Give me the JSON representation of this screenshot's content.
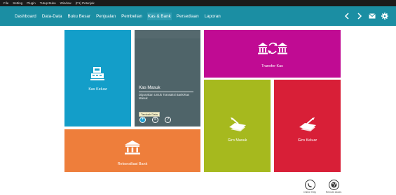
{
  "menubar": {
    "items": [
      "File",
      "Setting",
      "Plugin",
      "Tutup Buku",
      "Window",
      "(F1) Petunjuk"
    ]
  },
  "navbar": {
    "items": [
      "Dashboard",
      "Data-Data",
      "Buku Besar",
      "Penjualan",
      "Pembelian",
      "Kas & Bank",
      "Persediaan",
      "Laporan"
    ],
    "active": "Kas & Bank"
  },
  "tiles": {
    "kas_keluar": {
      "label": "Kas Keluar",
      "color": "#139ec9"
    },
    "kas_masuk": {
      "title": "Kas Masuk",
      "description": "Digunakan Untuk Transaksi Bank/Kas Masuk",
      "tooltip": "Tambah Data",
      "color": "#4f6469"
    },
    "transfer_kas": {
      "label": "Transfer Kas",
      "color": "#c00b93"
    },
    "giro_masuk": {
      "label": "Giro Masuk",
      "color": "#a6b91e"
    },
    "giro_keluar": {
      "label": "Giro Keluar",
      "color": "#d81f37"
    },
    "rekonsiliasi_bank": {
      "label": "Rekonsiliasi Bank",
      "color": "#ee7e3b"
    }
  },
  "bottom": {
    "online_help": "Online Help",
    "remote": "Remote Akses"
  }
}
